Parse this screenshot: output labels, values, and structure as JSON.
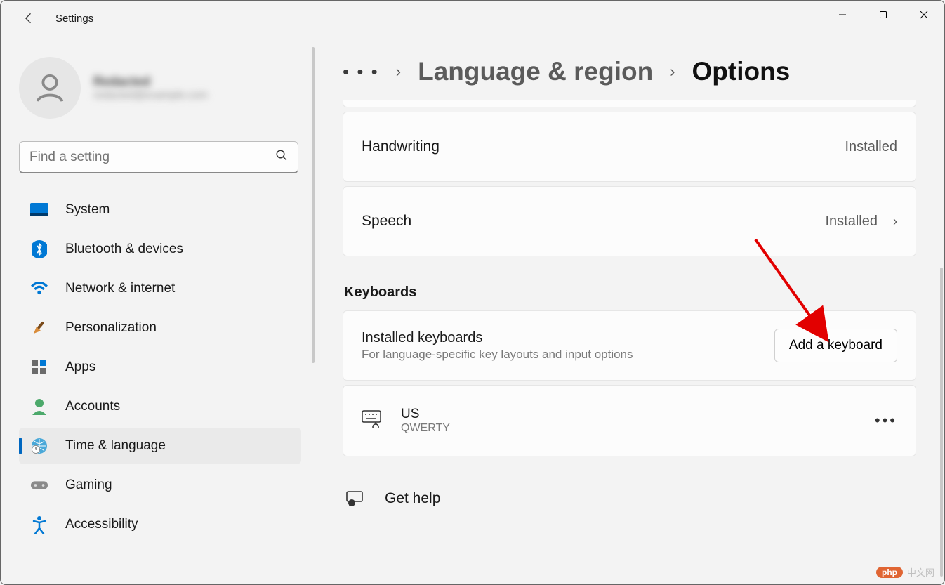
{
  "app": {
    "title": "Settings"
  },
  "profile": {
    "name": "Redacted",
    "email": "redacted@example.com"
  },
  "search": {
    "placeholder": "Find a setting"
  },
  "nav": [
    {
      "icon": "🖥️",
      "label": "System",
      "name": "system"
    },
    {
      "icon": "bt",
      "label": "Bluetooth & devices",
      "name": "bluetooth"
    },
    {
      "icon": "wifi",
      "label": "Network & internet",
      "name": "network"
    },
    {
      "icon": "🖌️",
      "label": "Personalization",
      "name": "personalization"
    },
    {
      "icon": "apps",
      "label": "Apps",
      "name": "apps"
    },
    {
      "icon": "acct",
      "label": "Accounts",
      "name": "accounts"
    },
    {
      "icon": "time",
      "label": "Time & language",
      "name": "time-language",
      "active": true
    },
    {
      "icon": "🎮",
      "label": "Gaming",
      "name": "gaming"
    },
    {
      "icon": "acc",
      "label": "Accessibility",
      "name": "accessibility"
    }
  ],
  "breadcrumb": {
    "parent": "Language & region",
    "current": "Options"
  },
  "cards": {
    "handwriting": {
      "title": "Handwriting",
      "status": "Installed"
    },
    "speech": {
      "title": "Speech",
      "status": "Installed"
    }
  },
  "keyboards": {
    "heading": "Keyboards",
    "installed_title": "Installed keyboards",
    "installed_sub": "For language-specific key layouts and input options",
    "add_button": "Add a keyboard",
    "items": [
      {
        "name": "US",
        "layout": "QWERTY"
      }
    ]
  },
  "help": {
    "label": "Get help"
  },
  "watermark": {
    "brand": "php",
    "text": "中文网"
  }
}
